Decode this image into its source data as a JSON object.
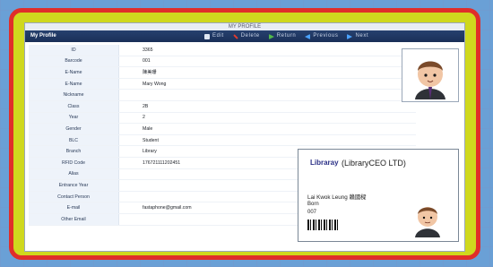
{
  "app": {
    "window_title": "MY PROFILE",
    "section_title": "My Profile"
  },
  "toolbar": {
    "edit_label": "Edit",
    "delete_label": "Delete",
    "return_label": "Return",
    "previous_label": "Previous",
    "next_label": "Next"
  },
  "profile": {
    "rows": [
      {
        "label": "ID",
        "value": "3365"
      },
      {
        "label": "Barcode",
        "value": "001"
      },
      {
        "label": "E-Name",
        "value": "陳美珊"
      },
      {
        "label": "E-Name",
        "value": "Mary Wong"
      },
      {
        "label": "Nickname",
        "value": ""
      },
      {
        "label": "Class",
        "value": "2B"
      },
      {
        "label": "Year",
        "value": "2"
      },
      {
        "label": "Gender",
        "value": "Male"
      },
      {
        "label": "BLC",
        "value": "Student"
      },
      {
        "label": "Branch",
        "value": "Library"
      },
      {
        "label": "RFID Code",
        "value": "176721111202451"
      },
      {
        "label": "Alias",
        "value": ""
      },
      {
        "label": "Entrance Year",
        "value": ""
      },
      {
        "label": "Contact Person",
        "value": ""
      },
      {
        "label": "E-mail",
        "value": "fastaphone@gmail.com"
      },
      {
        "label": "Other Email",
        "value": ""
      }
    ]
  },
  "card": {
    "brand": "Libraray",
    "company": "(LibraryCEO LTD)",
    "name": "Lai Kwok Leung 賴國樑",
    "line2": "Born",
    "line3": "007"
  },
  "icons": {
    "edit": "edit-icon",
    "delete": "delete-icon",
    "return": "return-icon",
    "previous": "previous-icon",
    "next": "next-icon",
    "avatar": "avatar-icon",
    "barcode": "barcode-icon"
  },
  "colors": {
    "frame_red": "#e02e2a",
    "outer_lime": "#cfd81e",
    "toolbar_navy": "#1f3763",
    "card_brand_blue": "#2a2f86"
  }
}
